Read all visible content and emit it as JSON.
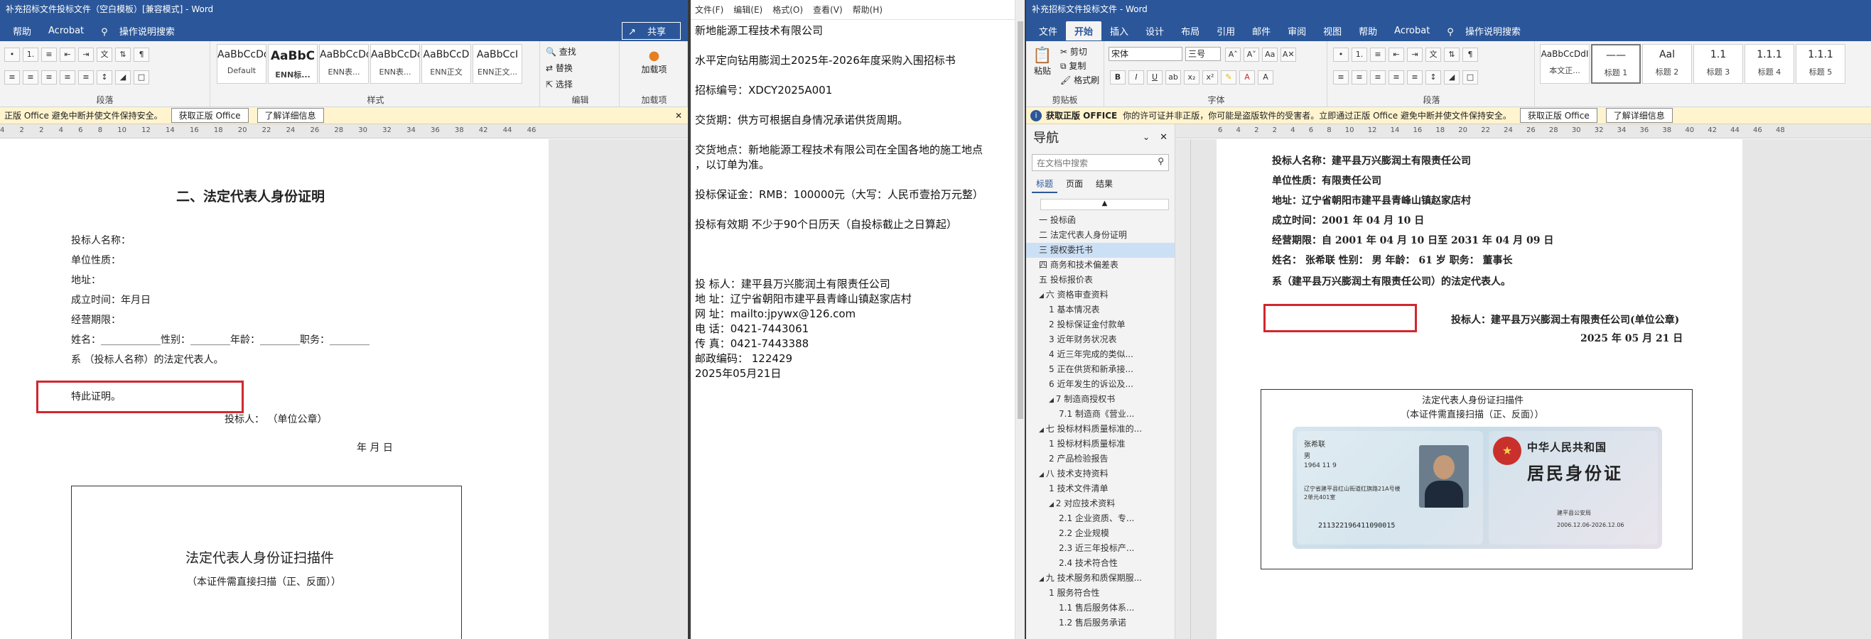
{
  "winA": {
    "title": "补充招标文件投标文件（空白模板）[兼容模式] - Word",
    "menu": [
      "帮助",
      "Acrobat",
      "操作说明搜索"
    ],
    "share": "共享",
    "groups": {
      "paragraph": "段落",
      "styles": "样式",
      "edit": "编辑",
      "addin": "加载项"
    },
    "styles": [
      {
        "sample": "AaBbCcDd",
        "name": "Default"
      },
      {
        "sample": "AaBbC",
        "name": "ENN标..."
      },
      {
        "sample": "AaBbCcDd",
        "name": "ENN表..."
      },
      {
        "sample": "AaBbCcDd",
        "name": "ENN表..."
      },
      {
        "sample": "AaBbCcD",
        "name": "ENN正文"
      },
      {
        "sample": "AaBbCcI",
        "name": "ENN正文..."
      }
    ],
    "edit": [
      "查找",
      "替换",
      "选择"
    ],
    "addin_label": "加载项",
    "notice": "正版 Office 避免中断并使文件保持安全。",
    "notice_btn1": "获取正版 Office",
    "notice_btn2": "了解详细信息",
    "ruler": "4 2 2 4 6 8 10 12 14 16 18 20 22 24 26 28 30 32 34 36 38 42 44 46",
    "doc": {
      "title": "二、法定代表人身份证明",
      "lines": [
        "投标人名称：",
        "单位性质：",
        "地址：",
        "成立时间：年月日",
        "经营期限：",
        "姓名：____________性别：________年龄：________职务：________",
        "系 （投标人名称）的法定代表人。",
        "",
        "特此证明。",
        "投标人：  （单位公章）",
        "",
        "年    月    日"
      ],
      "scan_title": "法定代表人身份证扫描件",
      "scan_sub": "（本证件需直接扫描（正、反面））"
    }
  },
  "winB": {
    "menu": [
      "文件(F)",
      "编辑(E)",
      "格式(O)",
      "查看(V)",
      "帮助(H)"
    ],
    "lines": [
      "新地能源工程技术有限公司",
      "",
      "水平定向钻用膨润土2025年-2026年度采购入围招标书",
      "",
      "招标编号：XDCY2025A001",
      "",
      "交货期：供方可根据自身情况承诺供货周期。",
      "",
      "交货地点：新地能源工程技术有限公司在全国各地的施工地点",
      "，以订单为准。",
      "",
      "投标保证金：RMB：100000元（大写：人民币壹拾万元整）",
      "",
      "投标有效期    不少于90个日历天（自投标截止之日算起）",
      "",
      "",
      "",
      "投  标人：建平县万兴膨润土有限责任公司",
      "地    址：辽宁省朝阳市建平县青峰山镇赵家店村",
      "网    址：mailto:jpywx@126.com",
      "电    话：0421-7443061",
      "传    真：0421-7443388",
      "邮政编码：  122429",
      "2025年05月21日"
    ]
  },
  "winC": {
    "title": "补充招标文件投标文件 - Word",
    "menu": [
      "文件",
      "开始",
      "插入",
      "设计",
      "布局",
      "引用",
      "邮件",
      "审阅",
      "视图",
      "帮助",
      "Acrobat",
      "操作说明搜索"
    ],
    "clipboard": [
      "粘贴",
      "剪切",
      "复制",
      "格式刷"
    ],
    "font_name": "宋体",
    "font_size": "三号",
    "groups": {
      "clipboard": "剪贴板",
      "font": "字体",
      "paragraph": "段落"
    },
    "styles": [
      {
        "sample": "AaBbCcDdI",
        "name": "本文正..."
      },
      {
        "sample": "——",
        "name": "标题 1"
      },
      {
        "sample": "Aal",
        "name": "标题 2"
      },
      {
        "sample": "1.1",
        "name": "标题 3"
      },
      {
        "sample": "1.1.1",
        "name": "标题 4"
      },
      {
        "sample": "1.1.1",
        "name": "标题 5"
      }
    ],
    "notice_label": "获取正版 OFFICE",
    "notice": "你的许可证并非正版，你可能是盗版软件的受害者。立即通过正版 Office 避免中断并使文件保持安全。",
    "notice_btn1": "获取正版 Office",
    "notice_btn2": "了解详细信息",
    "ruler": "6 4 2 2 4 6 8 10 12 14 16 18 20 22 24 26 28 30 32 34 36 38 40 42 44 46 48",
    "nav": {
      "title": "导航",
      "search": "在文档中搜索",
      "tabs": [
        "标题",
        "页面",
        "结果"
      ],
      "items": [
        {
          "text": "一 投标函",
          "level": 0
        },
        {
          "text": "二 法定代表人身份证明",
          "level": 0
        },
        {
          "text": "三 授权委托书",
          "level": 0,
          "selected": true
        },
        {
          "text": "四 商务和技术偏差表",
          "level": 0
        },
        {
          "text": "五 投标报价表",
          "level": 0
        },
        {
          "text": "六 资格审查资料",
          "level": 0,
          "expand": true
        },
        {
          "text": "1 基本情况表",
          "level": 1
        },
        {
          "text": "2 投标保证金付款单",
          "level": 1
        },
        {
          "text": "3 近年财务状况表",
          "level": 1
        },
        {
          "text": "4 近三年完成的类似...",
          "level": 1
        },
        {
          "text": "5 正在供货和新承接...",
          "level": 1
        },
        {
          "text": "6 近年发生的诉讼及...",
          "level": 1
        },
        {
          "text": "7 制造商授权书",
          "level": 1,
          "expand": true
        },
        {
          "text": "7.1 制造商《营业...",
          "level": 2
        },
        {
          "text": "七 投标材料质量标准的...",
          "level": 0,
          "expand": true
        },
        {
          "text": "1 投标材料质量标准",
          "level": 1
        },
        {
          "text": "2 产品检验报告",
          "level": 1
        },
        {
          "text": "八 技术支持资料",
          "level": 0,
          "expand": true
        },
        {
          "text": "1 技术文件清单",
          "level": 1
        },
        {
          "text": "2 对应技术资料",
          "level": 1,
          "expand": true
        },
        {
          "text": "2.1 企业资质、专...",
          "level": 2
        },
        {
          "text": "2.2 企业规模",
          "level": 2
        },
        {
          "text": "2.3 近三年投标产...",
          "level": 2
        },
        {
          "text": "2.4 技术符合性",
          "level": 2
        },
        {
          "text": "九 技术服务和质保期服...",
          "level": 0,
          "expand": true
        },
        {
          "text": "1 服务符合性",
          "level": 1
        },
        {
          "text": "1.1 售后服务体系...",
          "level": 2
        },
        {
          "text": "1.2 售后服务承诺",
          "level": 2
        }
      ]
    },
    "doc": {
      "lines": [
        "投标人名称：建平县万兴膨润土有限责任公司",
        "单位性质：有限责任公司",
        "地址：辽宁省朝阳市建平县青峰山镇赵家店村",
        "成立时间：2001 年 04 月 10 日",
        "经营期限：自 2001 年 04 月 10 日至 2031 年 04 月 09 日",
        "姓名： 张希联   性别：  男   年龄：  61 岁   职务：  董事长 ",
        "系（建平县万兴膨润土有限责任公司）的法定代表人。"
      ],
      "signer": "投标人：建平县万兴膨润土有限责任公司(单位公章)",
      "date": "2025 年 05 月 21 日",
      "scan_title": "法定代表人身份证扫描件",
      "scan_sub": "（本证件需直接扫描（正、反面））",
      "id_card": {
        "country": "中华人民共和国",
        "card_title": "居民身份证",
        "name_label": "张希联",
        "gender": "男",
        "birth": "1964 11 9",
        "addr": "辽宁省建平县红山街道红旗路21A号楼2单元401室",
        "id_number": "211322196411090015",
        "authority": "建平县公安局",
        "validity": "2006.12.06-2026.12.06"
      }
    }
  }
}
